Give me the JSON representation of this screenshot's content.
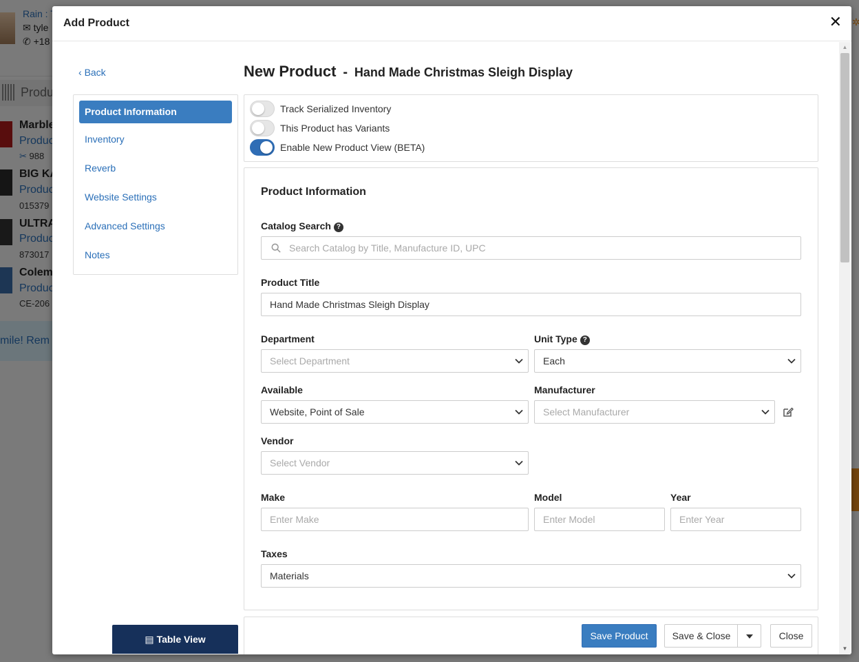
{
  "background": {
    "contact": {
      "name": "Rain : T",
      "email": "tyle",
      "phone": "+18"
    },
    "products_label": "Produ",
    "items": [
      {
        "title": "Marble",
        "link": "Produc",
        "sku": "988"
      },
      {
        "title": "BIG KA",
        "link": "Produc",
        "sku": "015379"
      },
      {
        "title": "ULTRA",
        "link": "Produc",
        "sku": "873017"
      },
      {
        "title": "Colem",
        "link": "Produc",
        "sku": "CE-206"
      }
    ],
    "banner": "mile! Rem"
  },
  "modal": {
    "title": "Add Product",
    "close_glyph": "✕"
  },
  "nav": {
    "back": "Back",
    "items": [
      {
        "label": "Product Information"
      },
      {
        "label": "Inventory"
      },
      {
        "label": "Reverb"
      },
      {
        "label": "Website Settings"
      },
      {
        "label": "Advanced Settings"
      },
      {
        "label": "Notes"
      }
    ],
    "active_index": 0,
    "table_view": "Table View"
  },
  "heading": {
    "main": "New Product",
    "dash": "-",
    "sub": "Hand Made Christmas Sleigh Display"
  },
  "toggles": [
    {
      "label": "Track Serialized Inventory",
      "on": false
    },
    {
      "label": "This Product has Variants",
      "on": false
    },
    {
      "label": "Enable New Product View (BETA)",
      "on": true
    }
  ],
  "form": {
    "section_title": "Product Information",
    "catalog_search": {
      "label": "Catalog Search",
      "placeholder": "Search Catalog by Title, Manufacture ID, UPC"
    },
    "product_title": {
      "label": "Product Title",
      "value": "Hand Made Christmas Sleigh Display"
    },
    "department": {
      "label": "Department",
      "placeholder": "Select Department"
    },
    "unit_type": {
      "label": "Unit Type",
      "value": "Each"
    },
    "available": {
      "label": "Available",
      "value": "Website, Point of Sale"
    },
    "manufacturer": {
      "label": "Manufacturer",
      "placeholder": "Select Manufacturer"
    },
    "vendor": {
      "label": "Vendor",
      "placeholder": "Select Vendor"
    },
    "make": {
      "label": "Make",
      "placeholder": "Enter Make"
    },
    "model": {
      "label": "Model",
      "placeholder": "Enter Model"
    },
    "year": {
      "label": "Year",
      "placeholder": "Enter Year"
    },
    "taxes": {
      "label": "Taxes",
      "value": "Materials"
    }
  },
  "footer": {
    "save_product": "Save Product",
    "save_close": "Save & Close",
    "close": "Close"
  },
  "colors": {
    "primary": "#3a7dc0",
    "dark_navy": "#16305a",
    "link": "#2a6fb8"
  }
}
